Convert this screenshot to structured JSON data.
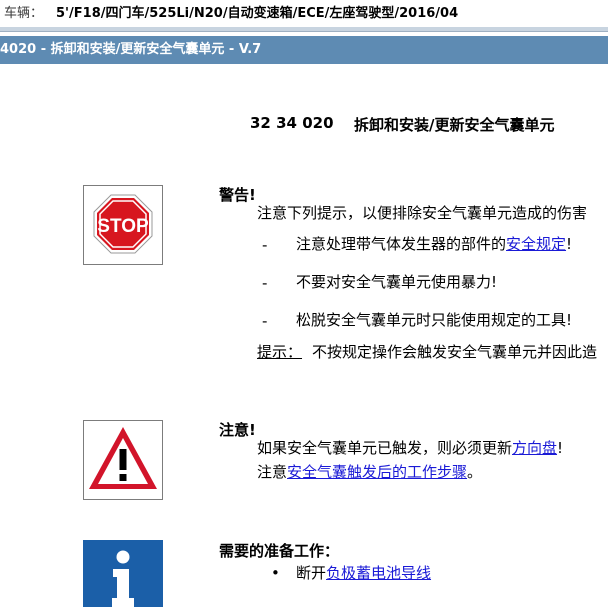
{
  "vehicle": {
    "label": "车辆：",
    "value": "5'/F18/四门车/525Li/N20/自动变速箱/ECE/左座驾驶型/2016/04"
  },
  "title_bar": {
    "text": "4020 - 拆卸和安装/更新安全气囊单元 - V.7"
  },
  "document": {
    "code": "32 34 020",
    "name": "拆卸和安装/更新安全气囊单元"
  },
  "warning": {
    "icon": "stop-sign-icon",
    "stop_text": "STOP",
    "title": "警告!",
    "intro": "注意下列提示，以便排除安全气囊单元造成的伤害",
    "items": [
      {
        "bullet": "-",
        "text": "注意处理带气体发生器的部件的",
        "link": "安全规定",
        "after": "!"
      },
      {
        "bullet": "-",
        "text": "不要对安全气囊单元使用暴力!",
        "link": "",
        "after": ""
      },
      {
        "bullet": "-",
        "text": "松脱安全气囊单元时只能使用规定的工具!",
        "link": "",
        "after": ""
      }
    ],
    "hint_label": "提示：",
    "hint_text": "不按规定操作会触发安全气囊单元并因此造"
  },
  "caution": {
    "icon": "caution-triangle-icon",
    "title": "注意!",
    "line1_text": "如果安全气囊单元已触发，则必须更新",
    "line1_link": "方向盘",
    "line1_after": "!",
    "line2_text": "注意",
    "line2_link": "安全气囊触发后的工作步骤",
    "line2_after": "。"
  },
  "prep": {
    "icon": "info-icon",
    "title": "需要的准备工作：",
    "bullet": "•",
    "item_text": "断开",
    "item_link": "负极蓄电池导线"
  },
  "colors": {
    "title_bar_bg": "#5e8bb3",
    "stop_red": "#d7161f",
    "caution_red": "#d2142a",
    "info_blue": "#1b5fa8",
    "link_blue": "#1a1ad6"
  }
}
